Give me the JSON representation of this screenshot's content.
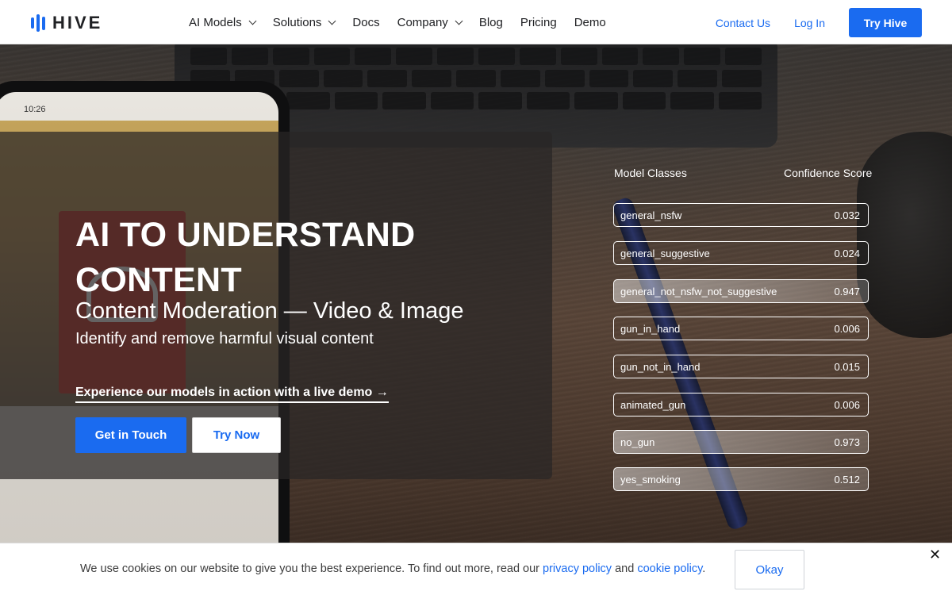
{
  "nav": {
    "logo_text": "HIVE",
    "menu": [
      {
        "label": "AI Models",
        "dropdown": true
      },
      {
        "label": "Solutions",
        "dropdown": true
      },
      {
        "label": "Docs",
        "dropdown": false
      },
      {
        "label": "Company",
        "dropdown": true
      },
      {
        "label": "Blog",
        "dropdown": false
      },
      {
        "label": "Pricing",
        "dropdown": false
      },
      {
        "label": "Demo",
        "dropdown": false
      }
    ],
    "contact_label": "Contact Us",
    "login_label": "Log In",
    "try_label": "Try Hive"
  },
  "hero": {
    "phone_time": "10:26",
    "title": "AI TO UNDERSTAND CONTENT",
    "subtitle": "Content Moderation — Video & Image",
    "tagline": "Identify and remove harmful visual content",
    "demo_link": "Experience our models in action with a live demo →",
    "primary_btn": "Get in Touch",
    "secondary_btn": "Try Now"
  },
  "panel": {
    "col_left": "Model Classes",
    "col_right": "Confidence Score",
    "rows": [
      {
        "label": "general_nsfw",
        "score": "0.032",
        "highlight": false
      },
      {
        "label": "general_suggestive",
        "score": "0.024",
        "highlight": false
      },
      {
        "label": "general_not_nsfw_not_suggestive",
        "score": "0.947",
        "highlight": true
      },
      {
        "label": "gun_in_hand",
        "score": "0.006",
        "highlight": false
      },
      {
        "label": "gun_not_in_hand",
        "score": "0.015",
        "highlight": false
      },
      {
        "label": "animated_gun",
        "score": "0.006",
        "highlight": false
      },
      {
        "label": "no_gun",
        "score": "0.973",
        "highlight": true
      },
      {
        "label": "yes_smoking",
        "score": "0.512",
        "highlight": true
      }
    ]
  },
  "cookie": {
    "text_before": "We use cookies on our website to give you the best experience. To find out more, read our ",
    "privacy_link": "privacy policy",
    "and": " and ",
    "cookie_link": "cookie policy",
    "period": ".",
    "okay_label": "Okay",
    "close_icon": "close-icon"
  },
  "colors": {
    "accent": "#1a6bf0"
  }
}
